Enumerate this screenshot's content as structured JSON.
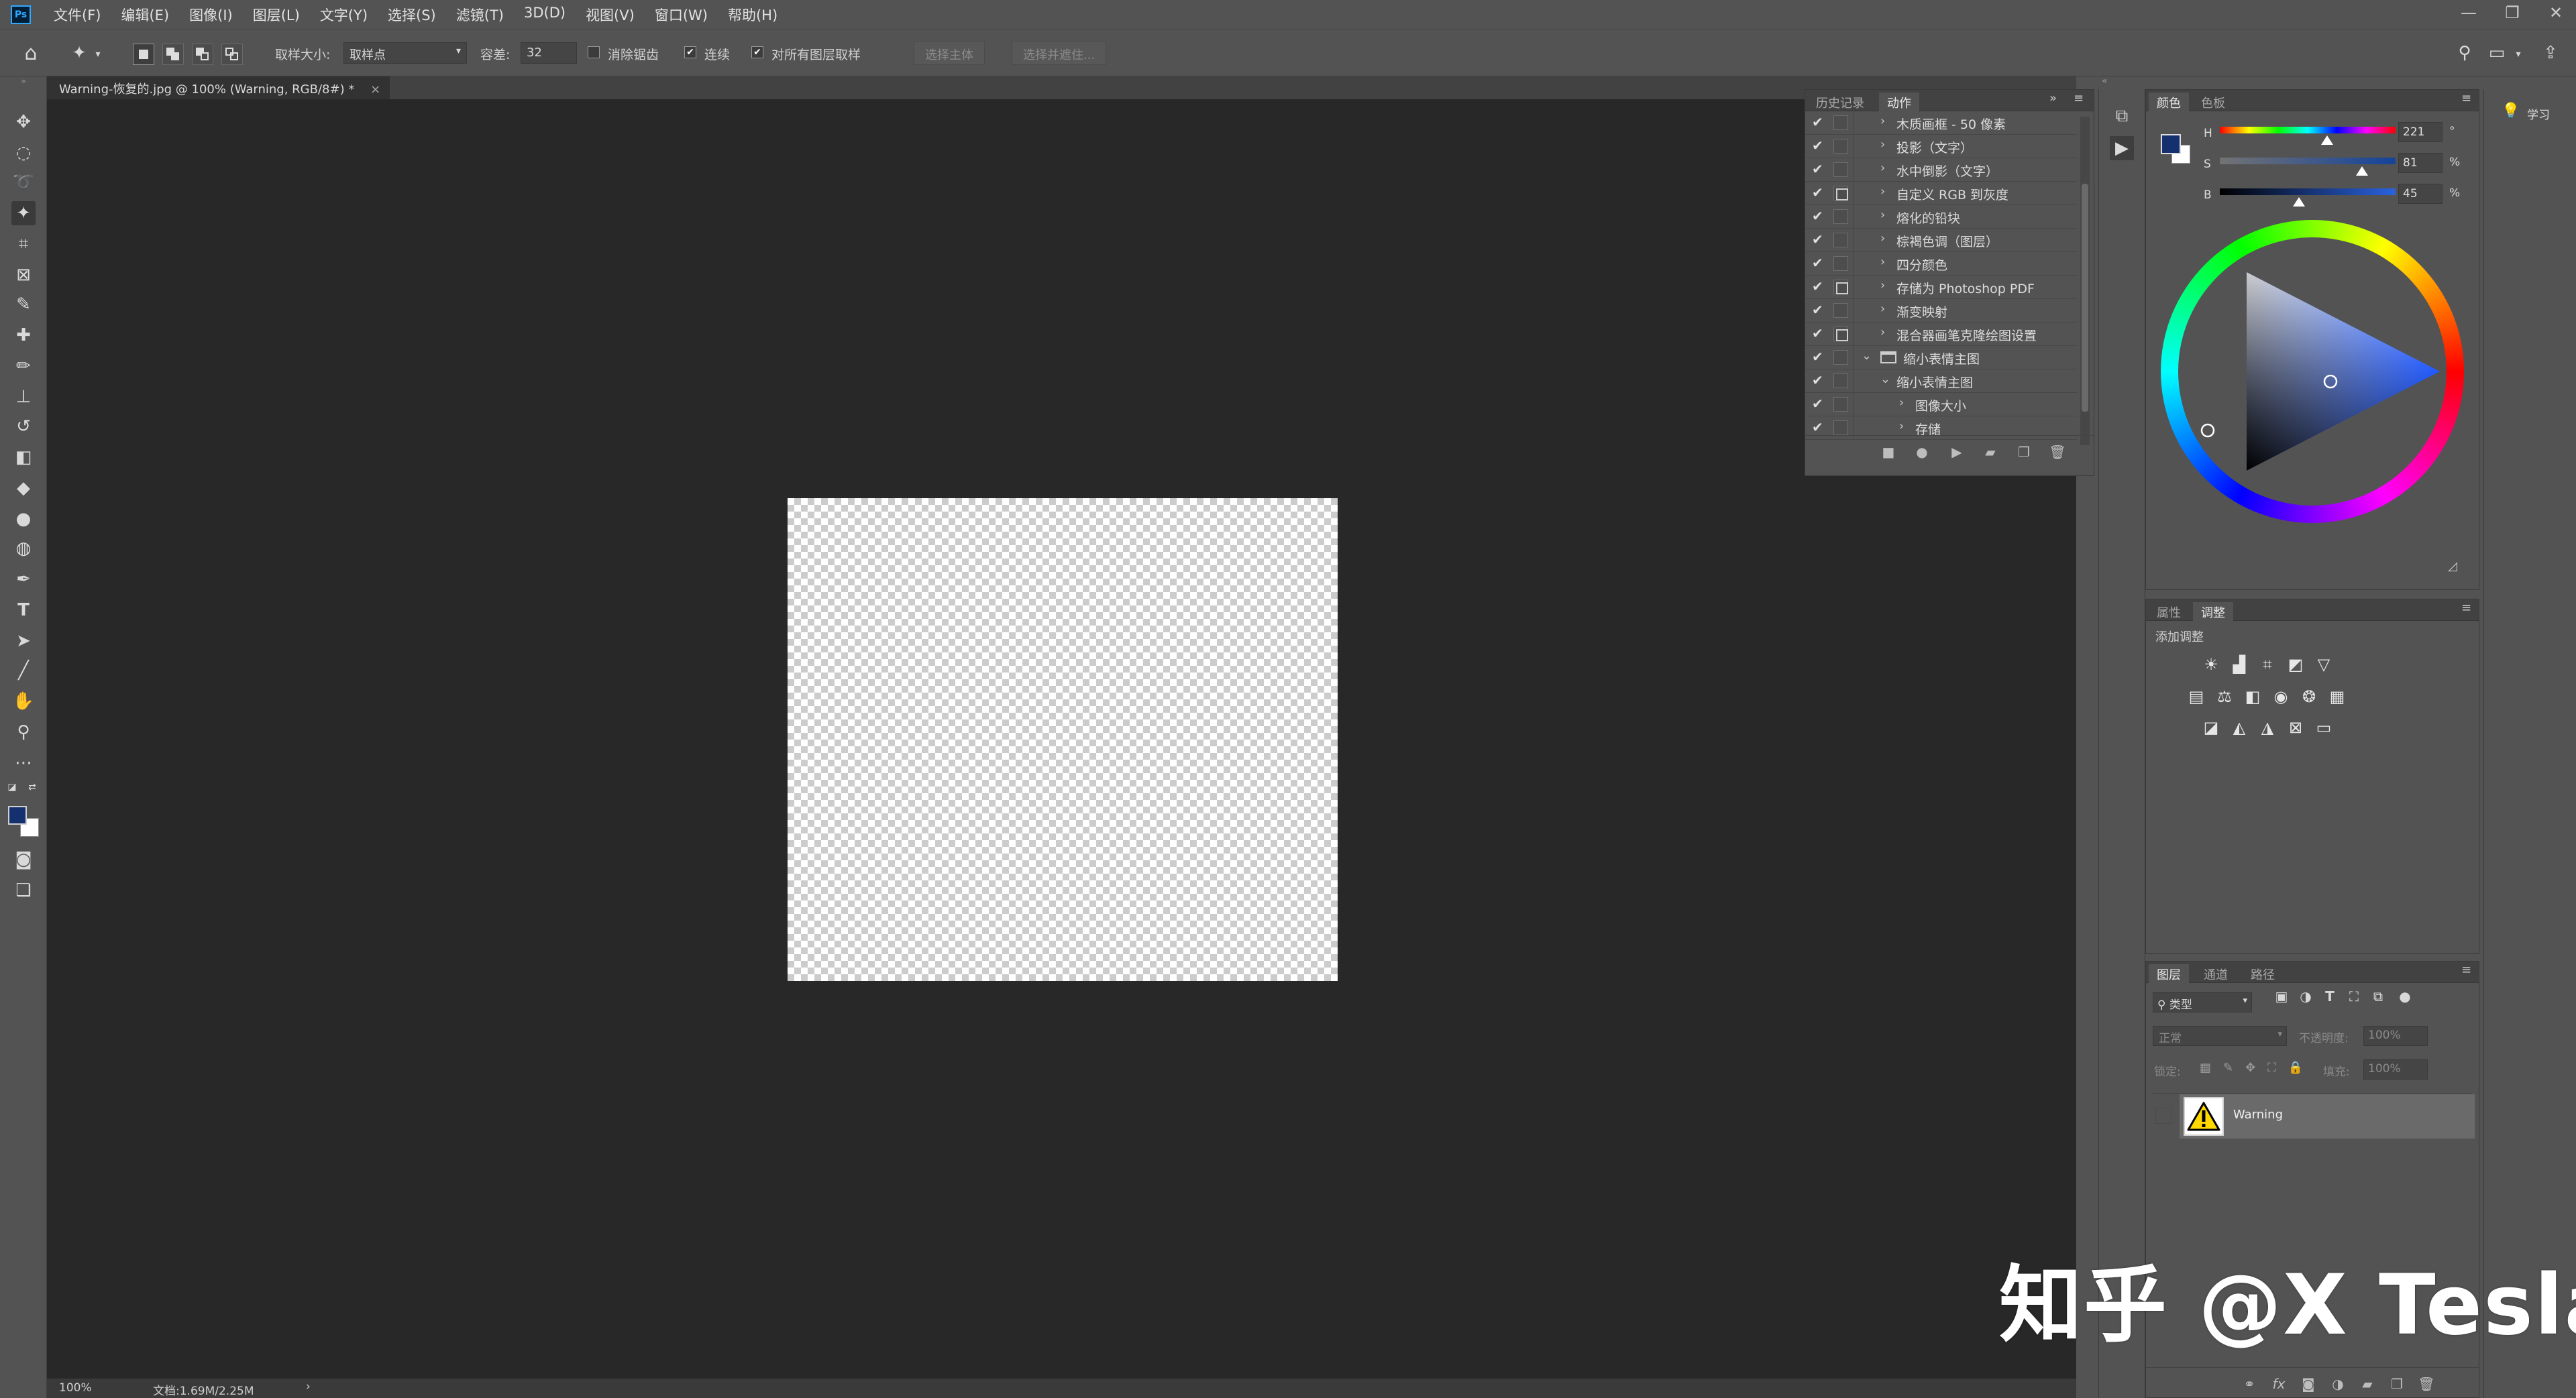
{
  "app": {
    "logo": "Ps"
  },
  "menu": [
    "文件(F)",
    "编辑(E)",
    "图像(I)",
    "图层(L)",
    "文字(Y)",
    "选择(S)",
    "滤镜(T)",
    "3D(D)",
    "视图(V)",
    "窗口(W)",
    "帮助(H)"
  ],
  "window_controls": {
    "minimize": "—",
    "restore": "❐",
    "close": "✕"
  },
  "options": {
    "sample_size_label": "取样大小:",
    "sample_size_value": "取样点",
    "tolerance_label": "容差:",
    "tolerance_value": "32",
    "anti_alias_label": "消除锯齿",
    "anti_alias_checked": false,
    "contiguous_label": "连续",
    "contiguous_checked": true,
    "sample_all_label": "对所有图层取样",
    "sample_all_checked": true,
    "select_subject_label": "选择主体",
    "select_mask_label": "选择并遮住..."
  },
  "document_tab": {
    "title": "Warning-恢复的.jpg @ 100% (Warning, RGB/8#) *",
    "close": "×"
  },
  "status": {
    "zoom": "100%",
    "doc_info": "文档:1.69M/2.25M",
    "arrow": "›"
  },
  "actions_panel": {
    "tabs": [
      "历史记录",
      "动作"
    ],
    "active_tab": 1,
    "rows": [
      {
        "label": "木质画框 - 50 像素",
        "checked": true,
        "dialog": false,
        "level": 1,
        "type": "action",
        "expanded": false
      },
      {
        "label": "投影（文字）",
        "checked": true,
        "dialog": false,
        "level": 1,
        "type": "action",
        "expanded": false
      },
      {
        "label": "水中倒影（文字）",
        "checked": true,
        "dialog": false,
        "level": 1,
        "type": "action",
        "expanded": false
      },
      {
        "label": "自定义 RGB 到灰度",
        "checked": true,
        "dialog": true,
        "level": 1,
        "type": "action",
        "expanded": false
      },
      {
        "label": "熔化的铅块",
        "checked": true,
        "dialog": false,
        "level": 1,
        "type": "action",
        "expanded": false
      },
      {
        "label": "棕褐色调（图层）",
        "checked": true,
        "dialog": false,
        "level": 1,
        "type": "action",
        "expanded": false
      },
      {
        "label": "四分颜色",
        "checked": true,
        "dialog": false,
        "level": 1,
        "type": "action",
        "expanded": false
      },
      {
        "label": "存储为 Photoshop PDF",
        "checked": true,
        "dialog": true,
        "level": 1,
        "type": "action",
        "expanded": false
      },
      {
        "label": "渐变映射",
        "checked": true,
        "dialog": false,
        "level": 1,
        "type": "action",
        "expanded": false
      },
      {
        "label": "混合器画笔克隆绘图设置",
        "checked": true,
        "dialog": true,
        "level": 1,
        "type": "action",
        "expanded": false
      },
      {
        "label": "缩小表情主图",
        "checked": true,
        "dialog": false,
        "level": 0,
        "type": "set",
        "expanded": true
      },
      {
        "label": "缩小表情主图",
        "checked": true,
        "dialog": false,
        "level": 1,
        "type": "action",
        "expanded": true
      },
      {
        "label": "图像大小",
        "checked": true,
        "dialog": false,
        "level": 2,
        "type": "step",
        "expanded": false
      },
      {
        "label": "存储",
        "checked": true,
        "dialog": false,
        "level": 2,
        "type": "step",
        "expanded": false
      }
    ],
    "buttons": [
      "stop-icon",
      "record-icon",
      "play-icon",
      "new-set-icon",
      "new-action-icon",
      "delete-icon"
    ]
  },
  "color_panel": {
    "tabs": [
      "颜色",
      "色板"
    ],
    "active_tab": 0,
    "fg_color": "#14306e",
    "bg_color": "#ffffff",
    "sliders": [
      {
        "label": "H",
        "value": "221",
        "unit": "°",
        "fraction": 0.61
      },
      {
        "label": "S",
        "value": "81",
        "unit": "%",
        "fraction": 0.81
      },
      {
        "label": "B",
        "value": "45",
        "unit": "%",
        "fraction": 0.45
      }
    ]
  },
  "adjustments_panel": {
    "tabs": [
      "属性",
      "调整"
    ],
    "active_tab": 1,
    "add_label": "添加调整",
    "rows": [
      [
        "brightness-icon",
        "levels-icon",
        "curves-icon",
        "exposure-icon",
        "vibrance-icon"
      ],
      [
        "hue-saturation-icon",
        "color-balance-icon",
        "black-white-icon",
        "photo-filter-icon",
        "channel-mixer-icon",
        "color-lookup-icon"
      ],
      [
        "invert-icon",
        "posterize-icon",
        "threshold-icon",
        "selective-color-icon",
        "gradient-map-icon"
      ]
    ]
  },
  "layers_panel": {
    "tabs": [
      "图层",
      "通道",
      "路径"
    ],
    "active_tab": 0,
    "filter_label": "类型",
    "blend_mode": "正常",
    "opacity_label": "不透明度:",
    "opacity_value": "100%",
    "lock_label": "锁定:",
    "fill_label": "填充:",
    "fill_value": "100%",
    "layers": [
      {
        "name": "Warning",
        "selected": true
      }
    ],
    "footer": [
      "link-icon",
      "fx-icon",
      "mask-icon",
      "adjustment-icon",
      "group-icon",
      "new-layer-icon",
      "delete-icon"
    ],
    "footer_fx_label": "fx"
  },
  "learn_panel": {
    "label": "学习"
  },
  "watermark": "知乎 @X Tesla"
}
